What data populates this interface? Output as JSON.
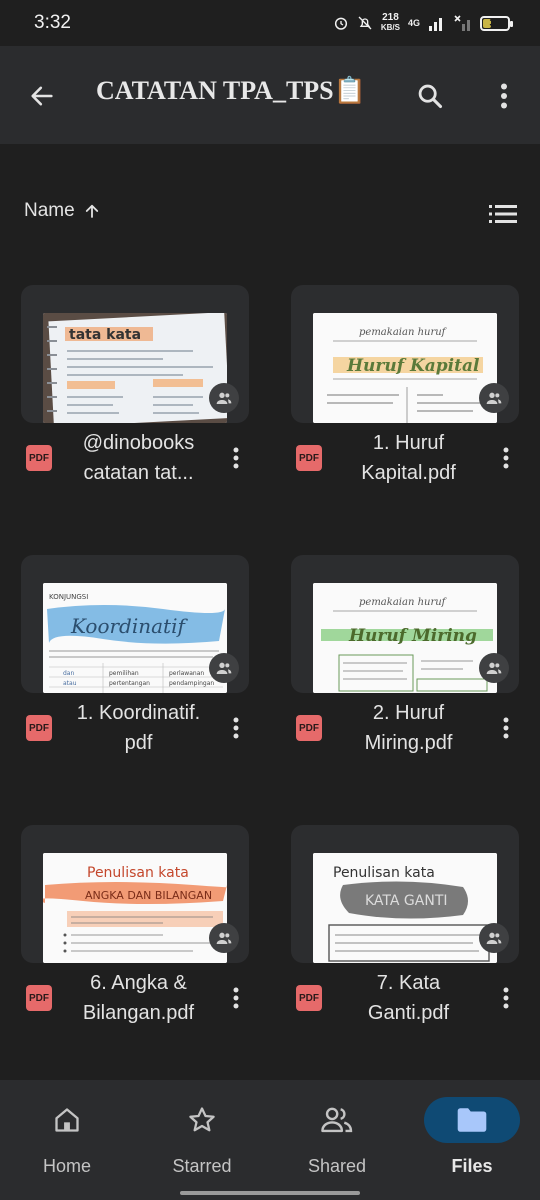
{
  "status_bar": {
    "time": "3:32",
    "speed_value": "218",
    "speed_unit": "KB/S",
    "network": "4G",
    "battery_level": "30",
    "battery_fraction": 0.3
  },
  "app_bar": {
    "title": "CATATAN TPA_TPS📋",
    "back_icon": "arrow-back-icon",
    "search_icon": "search-icon",
    "more_icon": "more-vert-icon"
  },
  "sort": {
    "label": "Name",
    "direction_icon": "arrow-up-icon",
    "view_icon": "list-view-icon"
  },
  "files": [
    {
      "name_line1": "@dinobooks",
      "name_line2": "catatan tat...",
      "type": "PDF",
      "thumb": "tata-kata"
    },
    {
      "name_line1": "1. Huruf",
      "name_line2": "Kapital.pdf",
      "type": "PDF",
      "thumb": "huruf-kapital"
    },
    {
      "name_line1": "1. Koordinatif.",
      "name_line2": "pdf",
      "type": "PDF",
      "thumb": "koordinatif"
    },
    {
      "name_line1": "2. Huruf",
      "name_line2": "Miring.pdf",
      "type": "PDF",
      "thumb": "huruf-miring"
    },
    {
      "name_line1": "6. Angka &",
      "name_line2": "Bilangan.pdf",
      "type": "PDF",
      "thumb": "angka-bilangan"
    },
    {
      "name_line1": "7. Kata",
      "name_line2": "Ganti.pdf",
      "type": "PDF",
      "thumb": "kata-ganti"
    }
  ],
  "bottom_nav": [
    {
      "label": "Home",
      "icon": "home-icon"
    },
    {
      "label": "Starred",
      "icon": "star-icon"
    },
    {
      "label": "Shared",
      "icon": "people-icon"
    },
    {
      "label": "Files",
      "icon": "folder-icon",
      "active": true
    }
  ],
  "colors": {
    "background": "#1f1f1f",
    "app_bar": "#2b2c2e",
    "pdf_badge": "#e66a6a",
    "active_nav": "#0f4a74",
    "folder_icon": "#a8c7fa"
  }
}
